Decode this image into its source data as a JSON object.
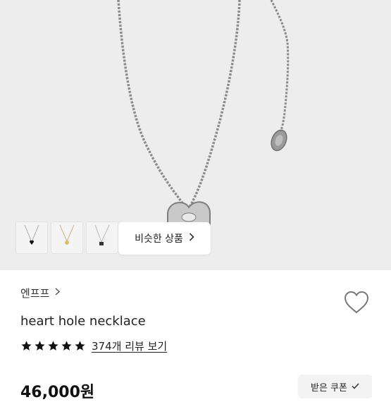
{
  "similar": {
    "label": "비슷한 상품"
  },
  "product": {
    "brand": "엔프프",
    "title": "heart hole necklace",
    "rating_stars": 5,
    "review_text": "374개 리뷰 보기",
    "price": "46,000원"
  },
  "coupon": {
    "label": "받은 쿠폰"
  },
  "icons": {
    "similar_chevron": "chevron-right-icon",
    "brand_chevron": "chevron-right-icon",
    "wishlist": "heart-outline-icon",
    "coupon_check": "check-icon",
    "star": "star-filled-icon"
  },
  "colors": {
    "hero_bg": "#ededed",
    "star": "#111111",
    "text": "#222222"
  }
}
